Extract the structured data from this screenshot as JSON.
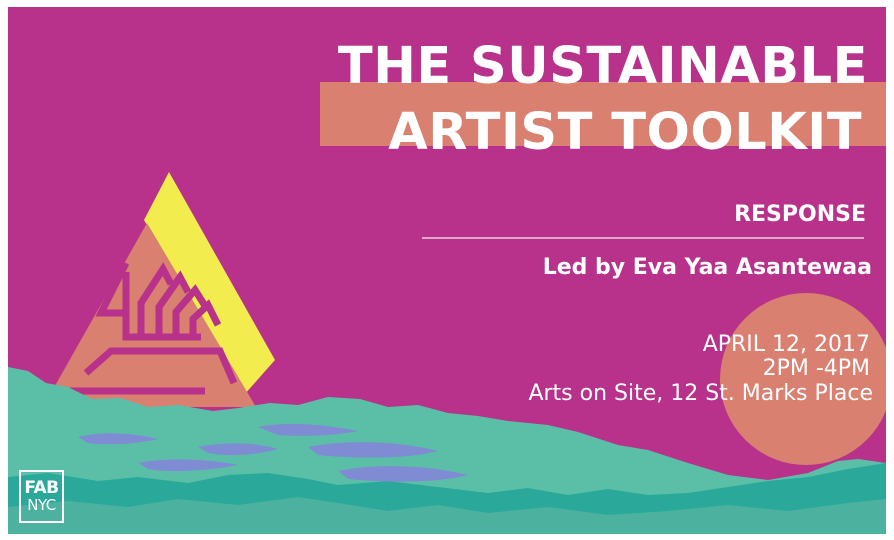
{
  "poster": {
    "title_line1": "THE SUSTAINABLE",
    "title_line2": "ARTIST TOOLKIT",
    "session": "RESPONSE",
    "leader": "Led by Eva Yaa Asantewaa",
    "date": "APRIL 12, 2017",
    "time": "2PM -4PM",
    "location": "Arts on Site, 12 St. Marks Place"
  },
  "logo": {
    "line1": "FAB",
    "line2": "NYC"
  },
  "colors": {
    "background": "#b8318a",
    "accent_salmon": "#d98070",
    "accent_yellow": "#f2ec4e",
    "water_teal": "#5bbfa8",
    "water_blue": "#7f8bd2",
    "text": "#ffffff"
  }
}
